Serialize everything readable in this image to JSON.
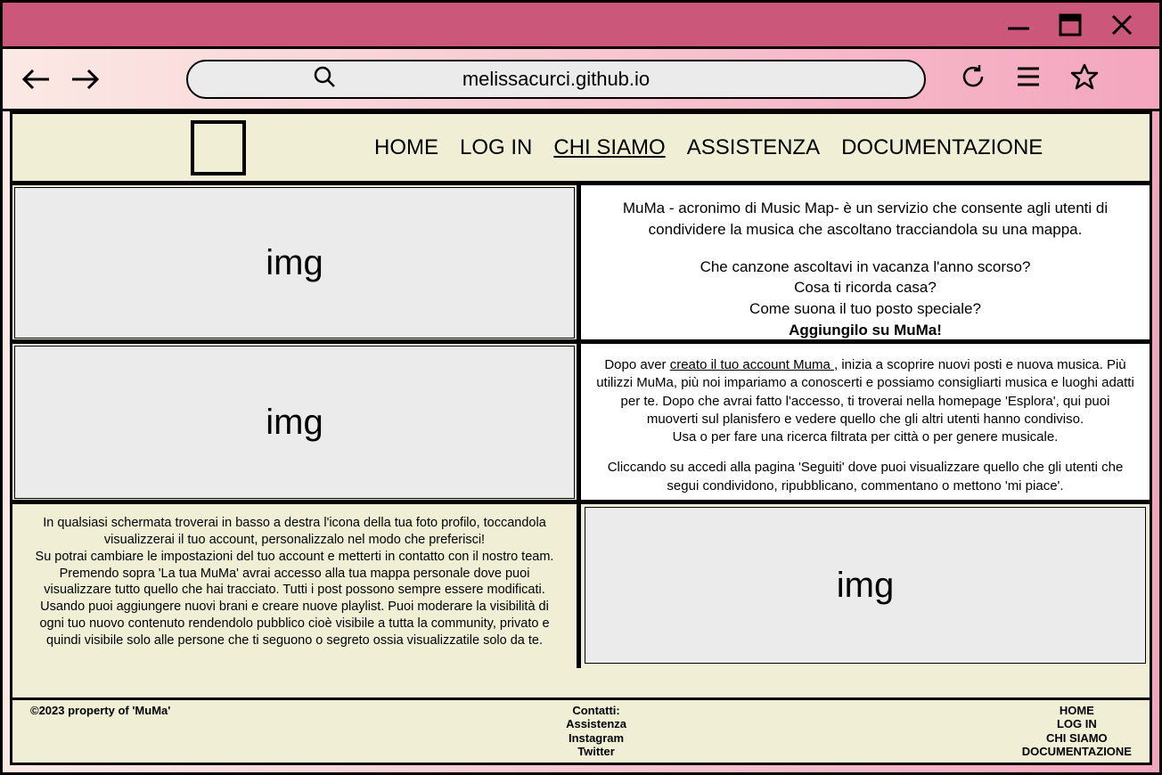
{
  "browser": {
    "url": "melissacurci.github.io"
  },
  "nav": {
    "home": "HOME",
    "login": "LOG IN",
    "chisiamo": "CHI SIAMO",
    "assistenza": "ASSISTENZA",
    "documentazione": "DOCUMENTAZIONE"
  },
  "row1": {
    "img": "img",
    "p1": "MuMa - acronimo di Music Map- è un servizio che consente agli utenti di condividere la musica che ascoltano tracciandola su una mappa.",
    "q1": "Che canzone ascoltavi in vacanza l'anno scorso?",
    "q2": "Cosa ti ricorda casa?",
    "q3": "Come suona il tuo posto speciale?",
    "cta": "Aggiungilo su MuMa!"
  },
  "row2": {
    "img": "img",
    "pre": "Dopo aver ",
    "link": "creato il tuo account Muma ",
    "post": ", inizia a scoprire nuovi posti e nuova musica. Più utilizzi MuMa, più noi impariamo a conoscerti e possiamo consigliarti musica e luoghi adatti per te. Dopo che avrai fatto l'accesso, ti troverai nella homepage 'Esplora', qui puoi muoverti sul planisfero e vedere quello che gli altri utenti hanno condiviso.",
    "p2": "Usa  o  per fare una ricerca filtrata per città o per genere musicale.",
    "p3": "Cliccando su  accedi alla pagina 'Seguiti' dove puoi visualizzare quello che gli utenti che segui condividono, ripubblicano, commentano o mettono 'mi piace'."
  },
  "row3": {
    "img": "img",
    "p1": "In qualsiasi schermata troverai in basso a destra l'icona della tua foto profilo, toccandola visualizzerai il tuo account, personalizzalo nel modo che preferisci!",
    "p2": "Su  potrai cambiare le impostazioni del tuo account e metterti in contatto con il nostro team.",
    "p3": "Premendo sopra 'La tua MuMa' avrai accesso alla tua mappa personale dove puoi visualizzare tutto quello che hai tracciato. Tutti i post possono sempre essere modificati.",
    "p4": "Usando  puoi aggiungere nuovi brani e creare nuove playlist. Puoi moderare la visibilità di ogni tuo nuovo contenuto rendendolo pubblico cioè visibile a tutta la community, privato e quindi visibile solo alle persone che ti seguono o segreto ossia visualizzatile solo da te."
  },
  "footer": {
    "copyright": "©2023 property of 'MuMa'",
    "contacts_label": "Contatti:",
    "assistenza": "Assistenza",
    "instagram": "Instagram",
    "twitter": "Twitter",
    "home": "HOME",
    "login": "LOG IN",
    "chisiamo": "CHI SIAMO",
    "documentazione": "DOCUMENTAZIONE"
  }
}
